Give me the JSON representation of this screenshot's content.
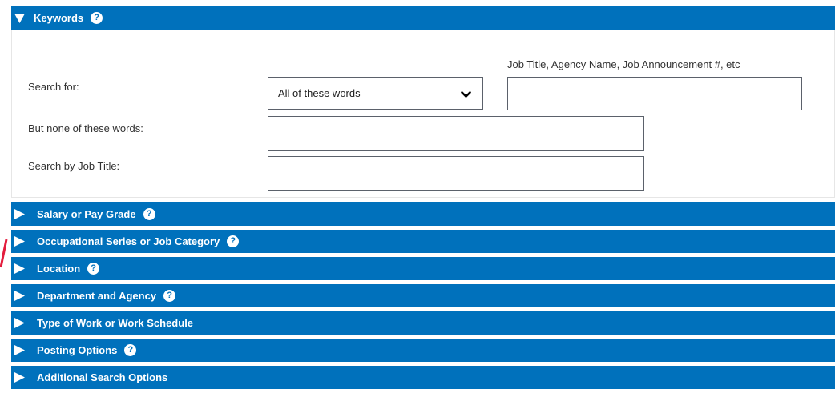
{
  "keywords": {
    "title": "Keywords",
    "help_glyph": "?",
    "hint": "Job Title, Agency Name, Job Announcement #, etc",
    "search_for_label": "Search for:",
    "search_mode_value": "All of these words",
    "none_label": "But none of these words:",
    "job_title_label": "Search by Job Title:"
  },
  "sections": [
    {
      "title": "Salary or Pay Grade",
      "help": "?"
    },
    {
      "title": "Occupational Series or Job Category",
      "help": "?"
    },
    {
      "title": "Location",
      "help": "?"
    },
    {
      "title": "Department and Agency",
      "help": "?"
    },
    {
      "title": "Type of Work or Work Schedule"
    },
    {
      "title": "Posting Options",
      "help": "?"
    },
    {
      "title": "Additional Search Options"
    }
  ],
  "colors": {
    "accent": "#0071bc",
    "annotation": "#e31c3d"
  },
  "icons": {
    "expanded": "triangle-down-icon",
    "collapsed": "triangle-right-icon",
    "help": "question-circle-icon",
    "select": "chevron-down-icon"
  }
}
